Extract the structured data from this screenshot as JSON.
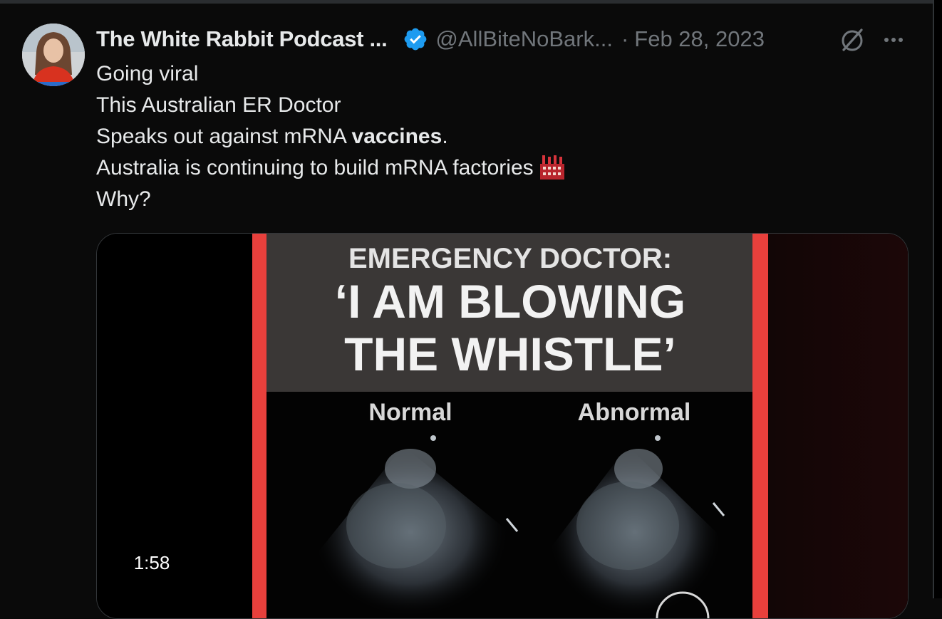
{
  "tweet": {
    "display_name": "The White Rabbit Podcast ...",
    "handle": "@AllBiteNoBark...",
    "separator": "·",
    "date": "Feb 28, 2023",
    "verified": true,
    "icons": [
      "verified-badge-icon",
      "grok-icon",
      "more-options-icon",
      "factory-emoji-icon"
    ],
    "text": {
      "line1": "Going viral",
      "line2": "This Australian ER Doctor",
      "line3_prefix": "Speaks out against mRNA ",
      "line3_bold": "vaccines",
      "line3_suffix": ".",
      "line4": "Australia is continuing to build mRNA factories",
      "line5": "Why?"
    }
  },
  "video": {
    "headline_top": "EMERGENCY DOCTOR:",
    "headline_line1": "‘I AM BLOWING",
    "headline_line2": "THE WHISTLE’",
    "label_left": "Normal",
    "label_right": "Abnormal",
    "duration": "1:58"
  },
  "colors": {
    "background": "#0a0a0a",
    "text": "#e7e9ea",
    "muted": "#71767b",
    "verified_blue": "#1d9bf0",
    "red_border": "#e8403c"
  }
}
